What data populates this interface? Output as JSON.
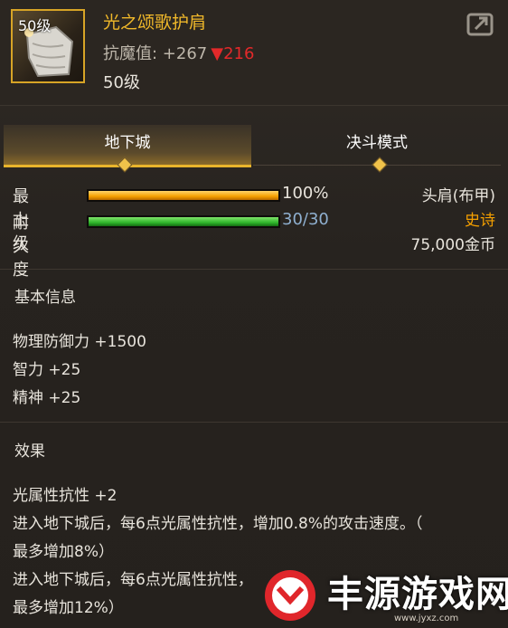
{
  "item": {
    "level_badge": "50级",
    "name": "光之颂歌护肩",
    "stat_label": "抗魔值: +267",
    "stat_change": "▼216",
    "required_level": "50级"
  },
  "tabs": [
    {
      "label": "地下城",
      "active": true
    },
    {
      "label": "决斗模式",
      "active": false
    }
  ],
  "bars": {
    "upgrade": {
      "label": "最上级",
      "value_text": "100%",
      "fraction": 1.0,
      "color": "#f5a000"
    },
    "durability": {
      "label": "耐久度",
      "value_text": "30/30",
      "fraction": 1.0,
      "color": "#2fb52b"
    }
  },
  "info": {
    "slot": "头肩(布甲)",
    "rarity": "史诗",
    "price": "75,000金币"
  },
  "basic_info": {
    "title": "基本信息",
    "lines": [
      "物理防御力 +1500",
      "智力 +25",
      "精神 +25"
    ]
  },
  "effects": {
    "title": "效果",
    "lines": [
      "光属性抗性 +2",
      "进入地下城后，每6点光属性抗性，增加0.8%的攻击速度。（",
      "最多增加8%）",
      "进入地下城后，每6点光属性抗性，",
      "最多增加12%）"
    ]
  },
  "watermark": {
    "text": "丰源游戏网",
    "url": "www.jyxz.com"
  },
  "colors": {
    "gold": "#f0b82a",
    "rarity": "#f5a000",
    "down": "#e3292a",
    "durability_text": "#8fb0d0"
  }
}
